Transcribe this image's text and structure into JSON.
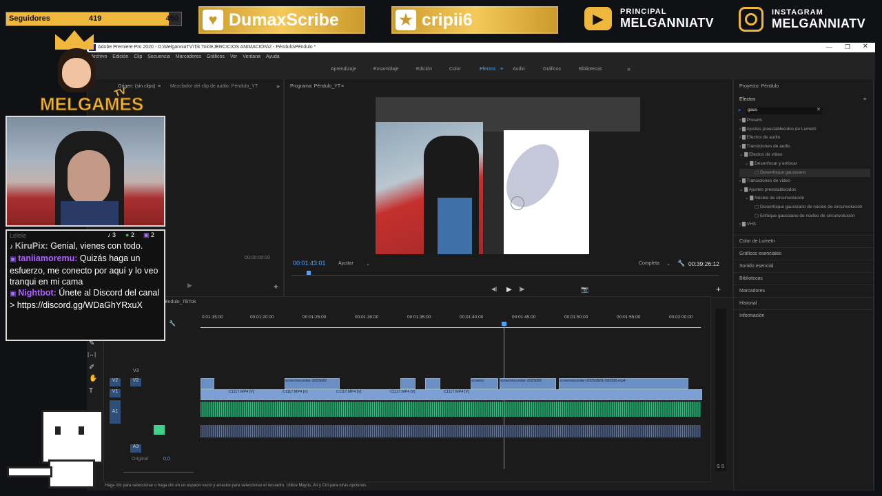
{
  "overlay": {
    "followers_label": "Seguidores",
    "followers_current": "419",
    "followers_goal": "450",
    "followers_progress": 0.93,
    "badge1": "DumaxScribe",
    "badge2": "cripii6",
    "youtube_small": "PRINCIPAL",
    "youtube_big": "MELGANNIATV",
    "instagram_small": "INSTAGRAM",
    "instagram_big": "MELGANNIATV",
    "logo_text": "MELGAMES",
    "logo_tv": "TV",
    "chat_stats": {
      "tiktok": "3",
      "xbox": "2",
      "twitch": "2"
    },
    "chat_faded": "Lelele",
    "chat": [
      {
        "user": "KiruPix:",
        "text": " Genial, vienes con todo.",
        "color": "#b9b9b9"
      },
      {
        "user": "taniiamoremu:",
        "text": " Quizás haga un esfuerzo, me conecto por aquí y lo veo tranqui en mi cama",
        "color": "#b062ff"
      },
      {
        "user": "Nightbot:",
        "text": " Únete al Discord del canal > https://discord.gg/WDaGhYRxuX",
        "color": "#b062ff"
      }
    ]
  },
  "premiere": {
    "title": "Adobe Premiere Pro 2020 - D:\\MelganniaTV\\Tik Tok\\EJERCICIOS ANIMACIÓN\\2 - Péndulo\\Péndulo *",
    "menu": [
      "Archivo",
      "Edición",
      "Clip",
      "Secuencia",
      "Marcadores",
      "Gráficos",
      "Ver",
      "Ventana",
      "Ayuda"
    ],
    "workspaces": [
      "Aprendizaje",
      "Ensamblaje",
      "Edición",
      "Color",
      "Efectos",
      "Audio",
      "Gráficos",
      "Bibliotecas"
    ],
    "active_workspace": "Efectos",
    "source_tab": "Origen: (sin clips)",
    "audio_mixer_tab": "Mezclador del clip de audio: Péndulo_YT",
    "program_tab": "Programa: Péndulo_YT",
    "source_timecode": "00:00:00:00",
    "program_timecode": "00:01:43:01",
    "fit_label": "Ajustar",
    "quality_label": "Completa",
    "duration": "00:39:26:12",
    "project_label": "Proyecto: Péndulo",
    "effects_title": "Efectos",
    "search_value": "gaus",
    "effects_tree": [
      "Presets",
      "Ajustes preestablecidos de Lumetri",
      "Efectos de audio",
      "Transiciones de audio",
      "Efectos de vídeo",
      "Desenfocar y enfocar",
      "Desenfoque gaussiano",
      "Transiciones de vídeo",
      "Ajustes preestablecidos",
      "Núcleo de circunvolución",
      "Desenfoque gaussiano de núcleo de circunvolución",
      "Enfoque gaussiano de núcleo de circunvolución",
      "VHS"
    ],
    "side_panels": [
      "Color de Lumetri",
      "Gráficos esenciales",
      "Sonido esencial",
      "Bibliotecas",
      "Marcadores",
      "Historial",
      "Información"
    ],
    "sequence_tab": "Péndulo_TikTok",
    "ruler": [
      "0:01:15:00",
      "00:01:20:00",
      "00:01:25:00",
      "00:01:30:00",
      "00:01:35:00",
      "00:01:40:00",
      "00:01:45:00",
      "00:01:50:00",
      "00:01:55:00",
      "00:02:00:00"
    ],
    "tracks": [
      "V3",
      "V2",
      "V1",
      "A1",
      "A2",
      "A3"
    ],
    "master_label": "Original",
    "master_value": "0,0",
    "v2_clips": [
      "screenrecorder-2025082",
      "screenr",
      "screenrecorder-2025082",
      "screenrecorder-20250828-190330.mp4"
    ],
    "v1_clip": "C1117.MP4 [V]",
    "status": "Haga clic para seleccionar o haga clic en un espacio vacío y arrastre para seleccionar el recuadro. Utilice Mayús, Alt y Ctrl para otras opciones.",
    "meter": "S S"
  }
}
